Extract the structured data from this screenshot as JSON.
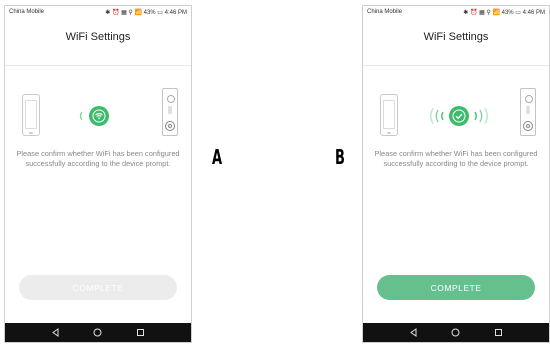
{
  "screens": [
    {
      "id": "a",
      "status": {
        "carrier": "China Mobile",
        "indicators": "✱ ⏰ ▦ ⚲ 📶 43% ▭ 4:46 PM"
      },
      "title": "WiFi Settings",
      "prompt": "Please confirm whether WiFi has been configured successfully according to the device prompt.",
      "button_label": "COMPLETE",
      "button_state": "disabled",
      "wifi_icon": "wifi-icon",
      "caption": "A"
    },
    {
      "id": "b",
      "status": {
        "carrier": "China Mobile",
        "indicators": "✱ ⏰ ▦ ⚲ 📶 43% ▭ 4:46 PM"
      },
      "title": "WiFi Settings",
      "prompt": "Please confirm whether WiFi has been configured successfully according to the device prompt.",
      "button_label": "COMPLETE",
      "button_state": "enabled",
      "wifi_icon": "check-icon",
      "caption": "B"
    }
  ],
  "colors": {
    "accent_green": "#3dbb6a",
    "button_enabled": "#66c08e",
    "button_disabled": "#ececec"
  }
}
